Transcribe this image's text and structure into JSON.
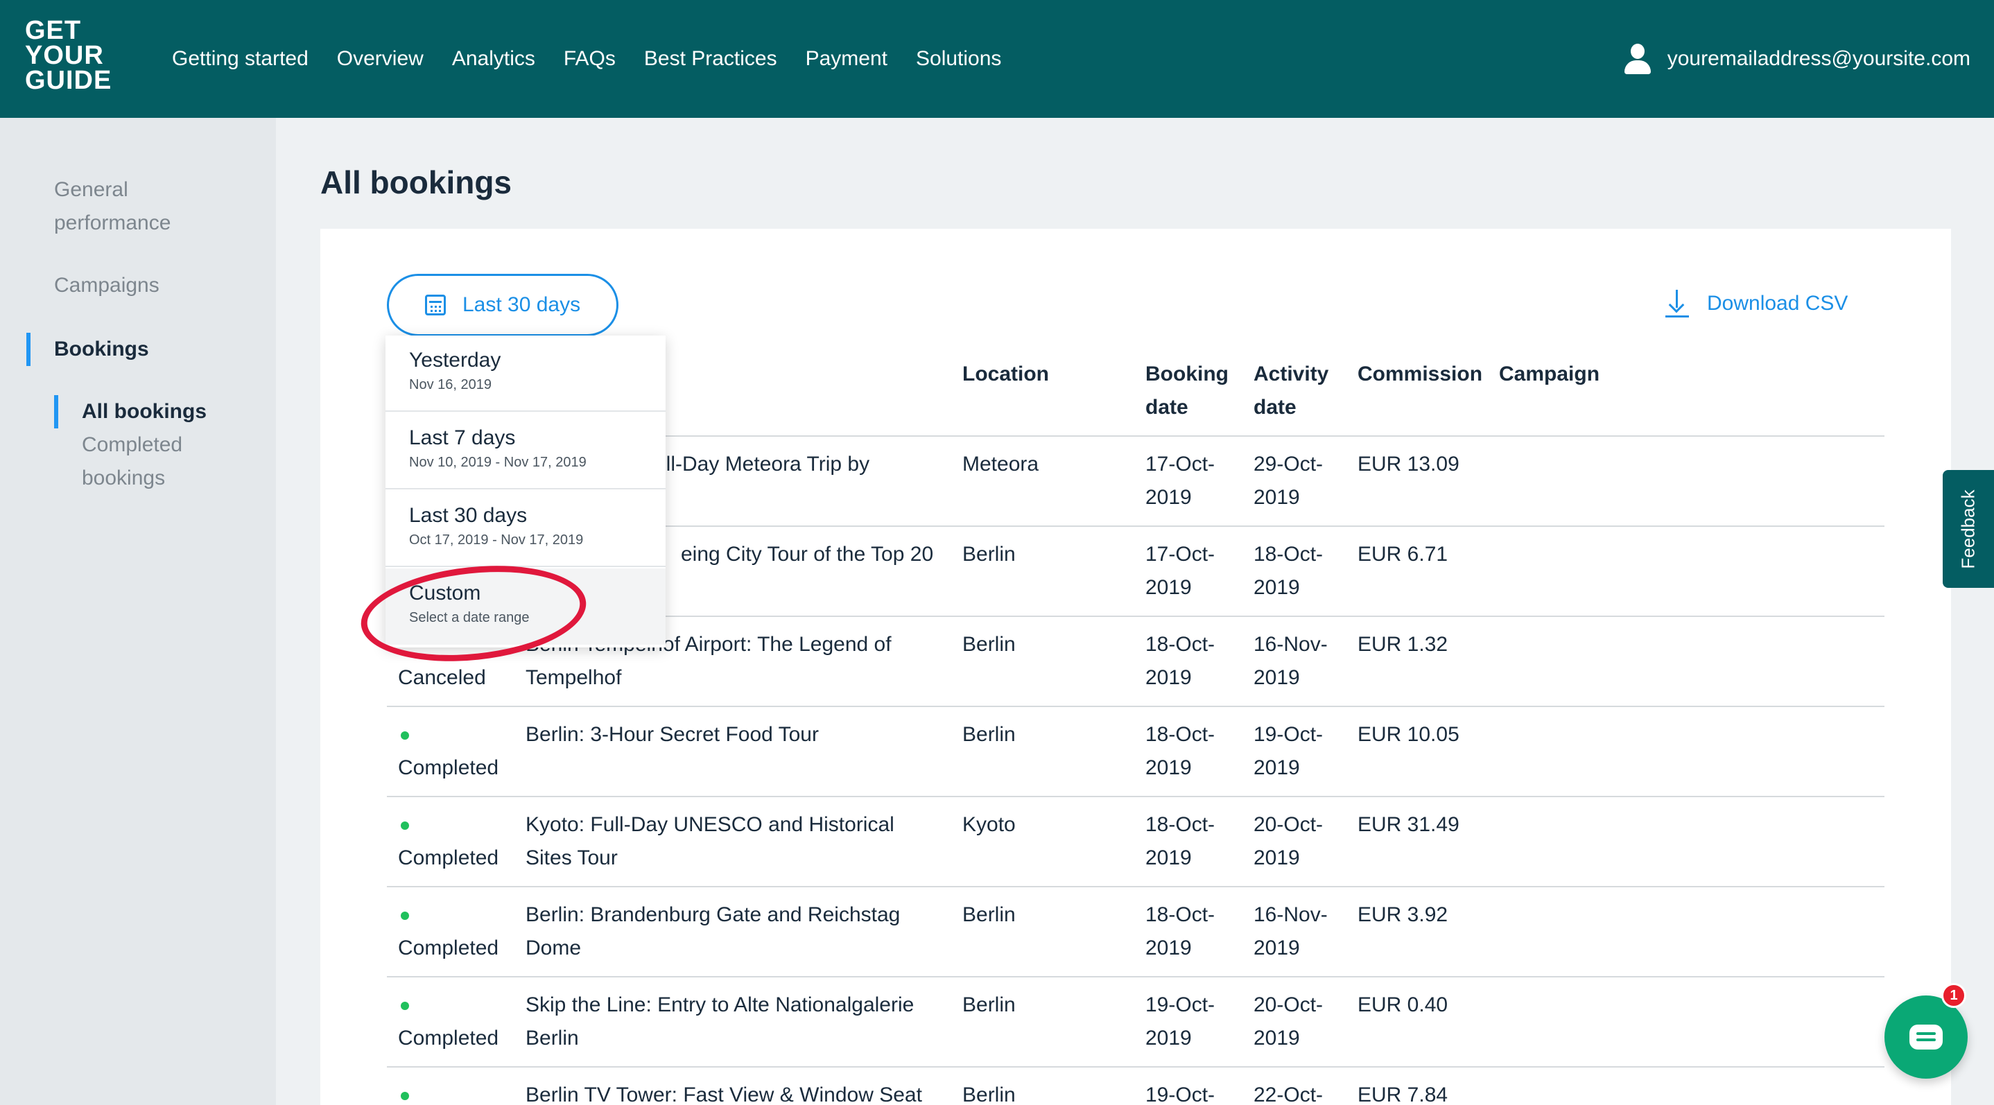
{
  "header": {
    "logo_lines": [
      "GET",
      "YOUR",
      "GUIDE"
    ],
    "nav": [
      "Getting started",
      "Overview",
      "Analytics",
      "FAQs",
      "Best Practices",
      "Payment",
      "Solutions"
    ],
    "user_email": "youremailaddress@yoursite.com"
  },
  "sidebar": {
    "general_line1": "General",
    "general_line2": "performance",
    "campaigns": "Campaigns",
    "bookings": "Bookings",
    "sub_all": "All bookings",
    "sub_completed_line1": "Completed",
    "sub_completed_line2": "bookings"
  },
  "main": {
    "title": "All bookings",
    "date_filter_label": "Last 30 days",
    "download_label": "Download CSV"
  },
  "table": {
    "headers": {
      "location": "Location",
      "booking_date_1": "Booking",
      "booking_date_2": "date",
      "activity_date_1": "Activity",
      "activity_date_2": "date",
      "commission": "Commission",
      "campaign": "Campaign"
    },
    "rows": [
      {
        "status": "",
        "activity1": "ull-Day Meteora Trip by",
        "activity2": "",
        "location": "Meteora",
        "booking1": "17-Oct-",
        "booking2": "2019",
        "act1": "29-Oct-",
        "act2": "2019",
        "commission": "EUR 13.09"
      },
      {
        "status": "",
        "activity1": "eing City Tour of the Top 20",
        "activity2": "",
        "location": "Berlin",
        "booking1": "17-Oct-",
        "booking2": "2019",
        "act1": "18-Oct-",
        "act2": "2019",
        "commission": "EUR 6.71"
      },
      {
        "status": "Canceled",
        "activity1": "Berlin Tempelhof Airport: The Legend of",
        "activity2": "Tempelhof",
        "location": "Berlin",
        "booking1": "18-Oct-",
        "booking2": "2019",
        "act1": "16-Nov-",
        "act2": "2019",
        "commission": "EUR 1.32"
      },
      {
        "status": "Completed",
        "activity1": "Berlin: 3-Hour Secret Food Tour",
        "activity2": "",
        "location": "Berlin",
        "booking1": "18-Oct-",
        "booking2": "2019",
        "act1": "19-Oct-",
        "act2": "2019",
        "commission": "EUR 10.05"
      },
      {
        "status": "Completed",
        "activity1": "Kyoto: Full-Day UNESCO and Historical",
        "activity2": "Sites Tour",
        "location": "Kyoto",
        "booking1": "18-Oct-",
        "booking2": "2019",
        "act1": "20-Oct-",
        "act2": "2019",
        "commission": "EUR 31.49"
      },
      {
        "status": "Completed",
        "activity1": "Berlin: Brandenburg Gate and Reichstag",
        "activity2": "Dome",
        "location": "Berlin",
        "booking1": "18-Oct-",
        "booking2": "2019",
        "act1": "16-Nov-",
        "act2": "2019",
        "commission": "EUR 3.92"
      },
      {
        "status": "Completed",
        "activity1": "Skip the Line: Entry to Alte Nationalgalerie",
        "activity2": "Berlin",
        "location": "Berlin",
        "booking1": "19-Oct-",
        "booking2": "2019",
        "act1": "20-Oct-",
        "act2": "2019",
        "commission": "EUR 0.40"
      },
      {
        "status": "",
        "activity1": "Berlin TV Tower: Fast View & Window Seat",
        "activity2": "",
        "location": "Berlin",
        "booking1": "19-Oct-",
        "booking2": "",
        "act1": "22-Oct-",
        "act2": "",
        "commission": "EUR 7.84"
      }
    ]
  },
  "dropdown": {
    "options": [
      {
        "label": "Yesterday",
        "sub": "Nov 16, 2019"
      },
      {
        "label": "Last 7 days",
        "sub": "Nov 10, 2019 - Nov 17, 2019"
      },
      {
        "label": "Last 30 days",
        "sub": "Oct 17, 2019 - Nov 17, 2019"
      },
      {
        "label": "Custom",
        "sub": "Select a date range"
      }
    ]
  },
  "feedback_label": "Feedback",
  "chat_badge_count": "1",
  "colors": {
    "header_bg": "#045d62",
    "accent_blue": "#1b8fe6",
    "status_green": "#20c05c",
    "highlight_red": "#e0183c",
    "chat_green": "#0aa875"
  },
  "icons": [
    "user-icon",
    "calendar-icon",
    "download-icon",
    "chat-icon"
  ]
}
